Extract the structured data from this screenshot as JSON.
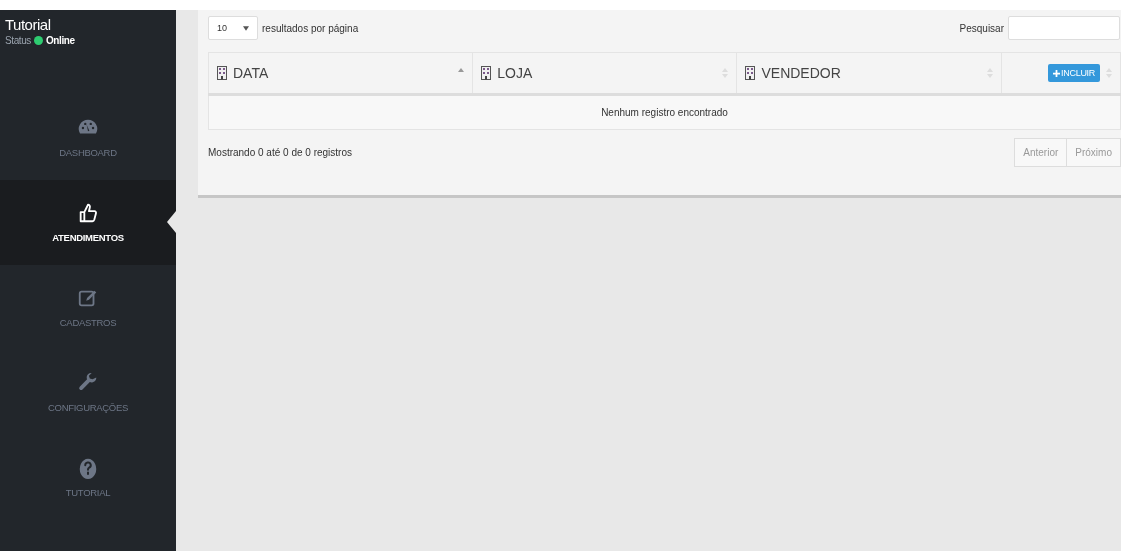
{
  "user": {
    "name": "Tutorial",
    "status_label": "Status",
    "status": "Online",
    "online": true
  },
  "nav": [
    {
      "label": "DASHBOARD",
      "selected": false
    },
    {
      "label": "ATENDIMENTOS",
      "selected": true
    },
    {
      "label": "CADASTROS",
      "selected": false
    },
    {
      "label": "CONFIGURAÇÕES",
      "selected": false
    },
    {
      "label": "TUTORIAL",
      "selected": false
    }
  ],
  "table": {
    "page_size": "10",
    "page_size_label": "resultados por página",
    "search_label": "Pesquisar",
    "columns": [
      {
        "label": "DATA",
        "sorted": true
      },
      {
        "label": "LOJA",
        "sorted": false
      },
      {
        "label": "VENDEDOR",
        "sorted": false
      },
      {
        "kind": "action",
        "button": "INCLUIR",
        "sorted": false
      }
    ],
    "empty": "Nenhum registro encontrado",
    "info": "Mostrando 0 até 0 de 0 registros",
    "pager": [
      {
        "label": "Anterior",
        "disabled": true
      },
      {
        "label": "Próximo",
        "disabled": true
      }
    ]
  }
}
